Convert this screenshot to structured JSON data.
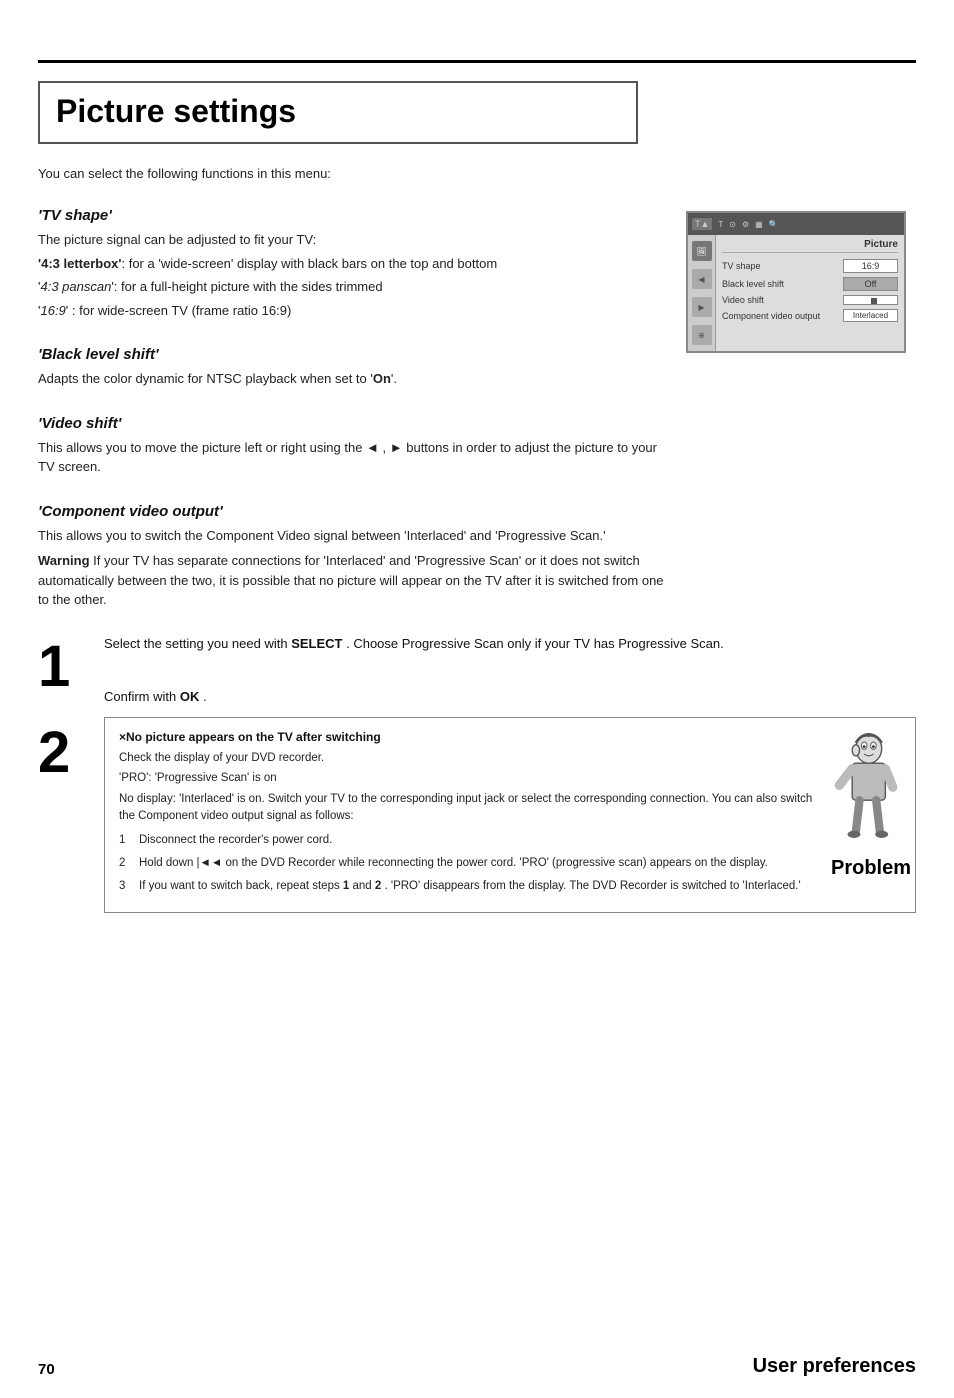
{
  "page": {
    "title": "Picture settings",
    "intro": "You can select the following functions in this menu:",
    "sections": [
      {
        "id": "tv-shape",
        "heading": "'TV shape'",
        "body": "The picture signal can be adjusted to fit your TV:",
        "bullets": [
          {
            "label": "'4:3 letterbox'",
            "label_style": "bold-italic",
            "text": ":  for a 'wide-screen' display with black bars on the top and bottom"
          },
          {
            "label": "'4:3 panscan'",
            "label_style": "italic",
            "text": ":  for a full-height picture with the sides trimmed"
          },
          {
            "label": "'16:9'",
            "label_style": "italic",
            "text": ":   for wide-screen TV (frame ratio 16:9)"
          }
        ]
      },
      {
        "id": "black-level-shift",
        "heading": "'Black level shift'",
        "body": "Adapts the color dynamic for NTSC playback when set to 'On'."
      },
      {
        "id": "video-shift",
        "heading": "'Video shift'",
        "body": "This allows you to move the picture left or right using the ◄ , ► buttons in order to adjust the picture to your TV screen."
      },
      {
        "id": "component-video-output",
        "heading": "'Component video output'",
        "body1": "This allows you to switch the Component Video signal between 'Interlaced' and 'Progressive Scan.'",
        "body2": "Warning If your TV has separate connections for 'Interlaced' and 'Progressive Scan' or it does not switch automatically between the two, it is possible that no picture will appear on the TV after it is switched from one to the other."
      }
    ],
    "tv_panel": {
      "title": "Picture",
      "rows": [
        {
          "label": "TV shape",
          "value": "16:9",
          "type": "value"
        },
        {
          "label": "Black level shift",
          "value": "Off",
          "type": "value-off"
        },
        {
          "label": "Video shift",
          "value": "",
          "type": "slider"
        },
        {
          "label": "Component video output",
          "value": "Interlaced",
          "type": "value"
        }
      ]
    },
    "steps": [
      {
        "num": "1",
        "text": "Select the setting you need with  SELECT . Choose Progressive Scan only if your TV has Progressive Scan."
      },
      {
        "num": "2",
        "confirm_text": "Confirm with  OK ."
      }
    ],
    "warning_box": {
      "title": "×No picture appears on the TV after switching",
      "intro": "Check the display of your DVD recorder.",
      "lines": [
        "'PRO': 'Progressive Scan' is on",
        "No display: 'Interlaced' is on. Switch your TV to the corresponding input jack or select the corresponding connection. You can also switch the Component video output signal as follows:"
      ],
      "items": [
        {
          "num": "1",
          "text": "Disconnect the recorder's power cord."
        },
        {
          "num": "2",
          "text": "Hold down |◄◄ on the DVD Recorder while reconnecting the power cord. 'PRO' (progressive scan) appears on the display."
        },
        {
          "num": "3",
          "text": "If you want to switch back, repeat steps 1 and 2 . 'PRO' disappears from the display. The DVD Recorder is switched to 'Interlaced.'"
        }
      ]
    },
    "problem_label": "Problem",
    "footer": {
      "page_num": "70",
      "category": "User preferences"
    }
  }
}
